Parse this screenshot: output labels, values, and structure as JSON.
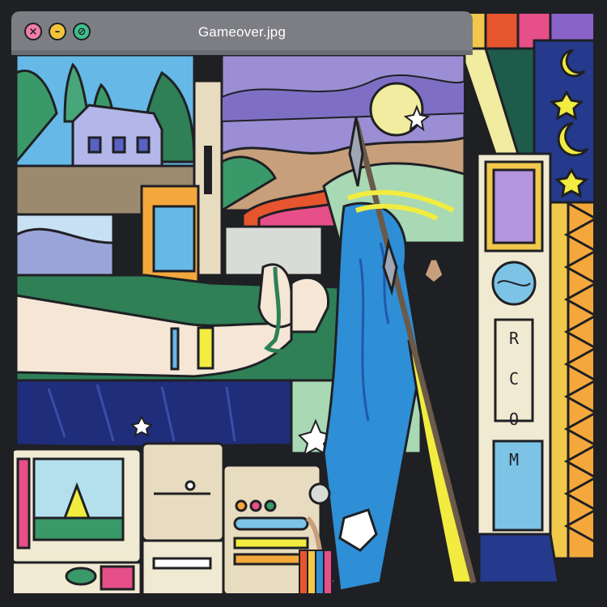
{
  "window": {
    "title": "Gameover.jpg",
    "controls": {
      "close_glyph": "×",
      "minimize_glyph": "–",
      "zoom_glyph": "⊘"
    }
  },
  "illustration": {
    "poster_text": "RCOM",
    "colors": {
      "outline": "#1f2024",
      "titlebar": "#7d7e84",
      "sky_blue": "#66b8e6",
      "dusk_purple": "#9b8ed4",
      "moon_yellow": "#f1ec9f",
      "hill_green": "#3a9968",
      "skin": "#f5e6d6",
      "blanket_navy": "#1f2d7a",
      "flag_blue": "#2e8ed6",
      "night_blue": "#253a8c",
      "accent_orange": "#f48c2a",
      "accent_pink": "#e64f88",
      "cream": "#f1ead2"
    }
  }
}
